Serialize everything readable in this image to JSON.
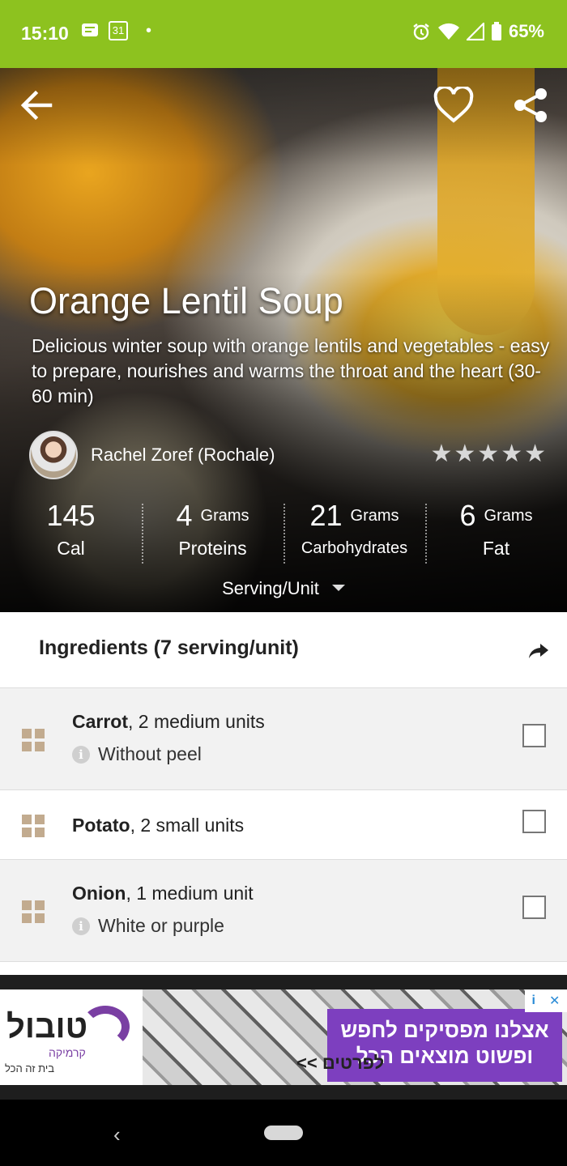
{
  "status_bar": {
    "time": "15:10",
    "battery": "65%",
    "dot": "•",
    "calendar_day": "31"
  },
  "recipe": {
    "title": "Orange Lentil Soup",
    "description": "Delicious winter soup with orange lentils and vegetables - easy to prepare, nourishes and warms the throat and the heart (30-60 min)",
    "author": "Rachel Zoref (Rochale)",
    "rating": 5,
    "stats": [
      {
        "value": "145",
        "unit": "",
        "label": "Cal"
      },
      {
        "value": "4",
        "unit": "Grams",
        "label": "Proteins"
      },
      {
        "value": "21",
        "unit": "Grams",
        "label": "Carbohydrates"
      },
      {
        "value": "6",
        "unit": "Grams",
        "label": "Fat"
      }
    ],
    "serving_selector": "Serving/Unit"
  },
  "ingredients": {
    "header": "Ingredients (7 serving/unit)",
    "items": [
      {
        "name": "Carrot",
        "amount": ", 2 medium units",
        "note": "Without peel"
      },
      {
        "name": "Potato",
        "amount": ", 2 small units",
        "note": ""
      },
      {
        "name": "Onion",
        "amount": ", 1 medium unit",
        "note": "White or purple"
      }
    ]
  },
  "ad": {
    "brand": "טובול",
    "brand_sub": "קרמיקה",
    "brand_tagline": "בית זה הכל",
    "headline_line1": "אצלנו מפסיקים לחפש",
    "headline_line2": "ופשוט מוצאים הכל",
    "cta": "<< לפרטים",
    "adchoices_info": "i",
    "adchoices_close": "✕"
  },
  "colors": {
    "status_bar": "#8dc21f",
    "grid_icon": "#c2ab8f",
    "ad_purple": "#7d3fbf"
  },
  "icons": [
    "back-arrow-icon",
    "heart-icon",
    "share-icon",
    "star-icon",
    "grid-icon",
    "info-icon",
    "forward-share-icon",
    "checkbox"
  ]
}
